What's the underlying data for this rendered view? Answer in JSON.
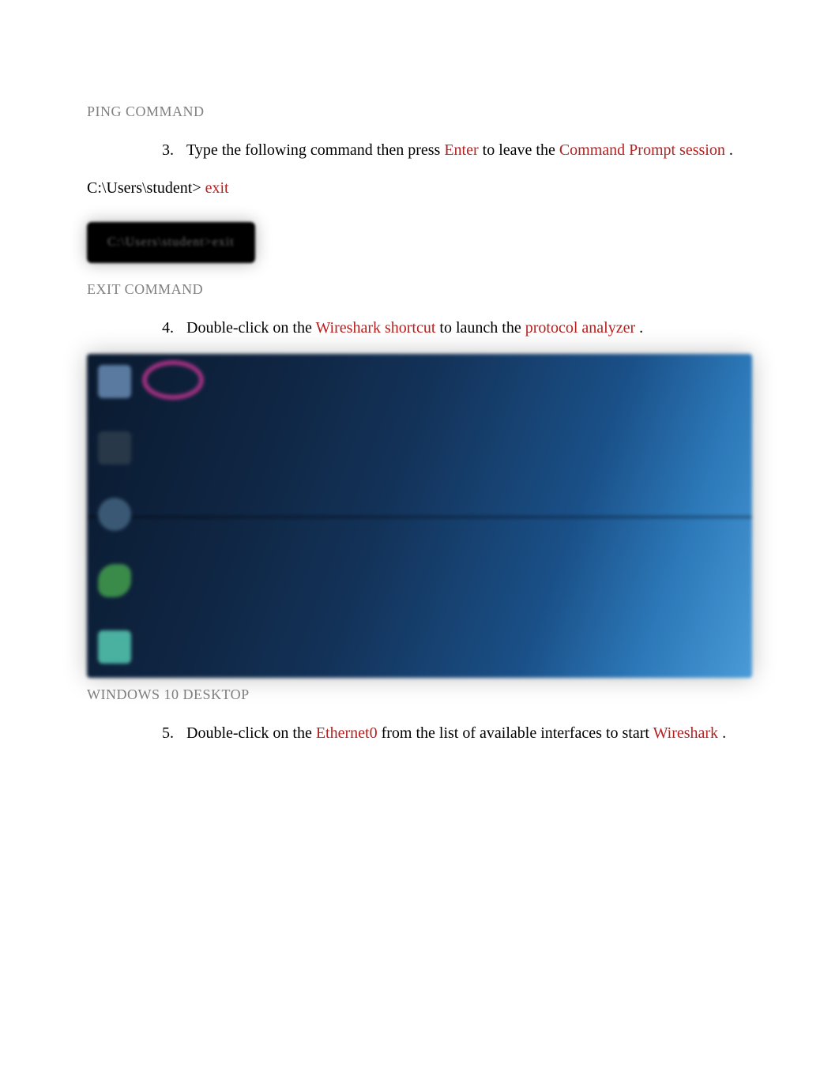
{
  "captions": {
    "ping": "PING COMMAND",
    "exit": "EXIT COMMAND",
    "desktop": "WINDOWS 10 DESKTOP"
  },
  "step3": {
    "number": "3.",
    "t1": "Type ",
    "t2": " the following command then  ",
    "t3": " press  ",
    "enter": " Enter ",
    "t4": " to leave the  ",
    "cmdprompt": " Command Prompt session ",
    "t5": " ."
  },
  "cmdline": {
    "prompt": "C:\\Users\\student>  ",
    "cmd": " exit "
  },
  "cmdbox": "C:\\Users\\student>exit",
  "step4": {
    "number": "4.",
    "t1": " Double-click  ",
    "t2": "  on the  ",
    "wshortcut": "Wireshark shortcut ",
    "t3": "   to launch the  ",
    "panalyzer": " protocol analyzer ",
    "t4": "  ."
  },
  "step5": {
    "number": "5.",
    "t1": " Double-click  ",
    "t2": "  on the  ",
    "eth": "Ethernet0 ",
    "t3": "  from the list of available interfaces to start ",
    "wireshark": " Wireshark ",
    "t4": "  ."
  }
}
